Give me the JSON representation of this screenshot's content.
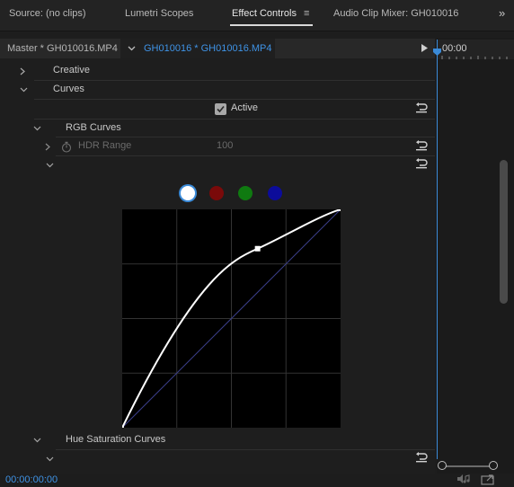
{
  "tabs": [
    {
      "label": "Source: (no clips)",
      "active": false
    },
    {
      "label": "Lumetri Scopes",
      "active": false
    },
    {
      "label": "Effect Controls",
      "active": true
    },
    {
      "label": "Audio Clip Mixer: GH010016",
      "active": false
    }
  ],
  "menu_icon": "≡",
  "overflow_icon": "»",
  "clip_bar": {
    "master_label": "Master * GH010016.MP4",
    "clip_label": "GH010016 * GH010016.MP4"
  },
  "ruler_time": "00:00",
  "sections": {
    "creative": "Creative",
    "curves": "Curves",
    "active_label": "Active",
    "active_checked": true,
    "rgb_curves": "RGB Curves",
    "hdr_range_label": "HDR Range",
    "hdr_range_value": "100",
    "hue_sat_curves": "Hue Saturation Curves"
  },
  "channels": [
    {
      "name": "white",
      "color": "#ffffff",
      "selected": true
    },
    {
      "name": "red",
      "color": "#7a0a0a",
      "selected": false
    },
    {
      "name": "green",
      "color": "#0f7a10",
      "selected": false
    },
    {
      "name": "blue",
      "color": "#0c0c9a",
      "selected": false
    }
  ],
  "curve": {
    "control_point": {
      "input": 0.62,
      "output": 0.82
    }
  },
  "timecode": "00:00:00:00",
  "colors": {
    "accent": "#3f93e6",
    "playhead": "#3a8ad8"
  }
}
